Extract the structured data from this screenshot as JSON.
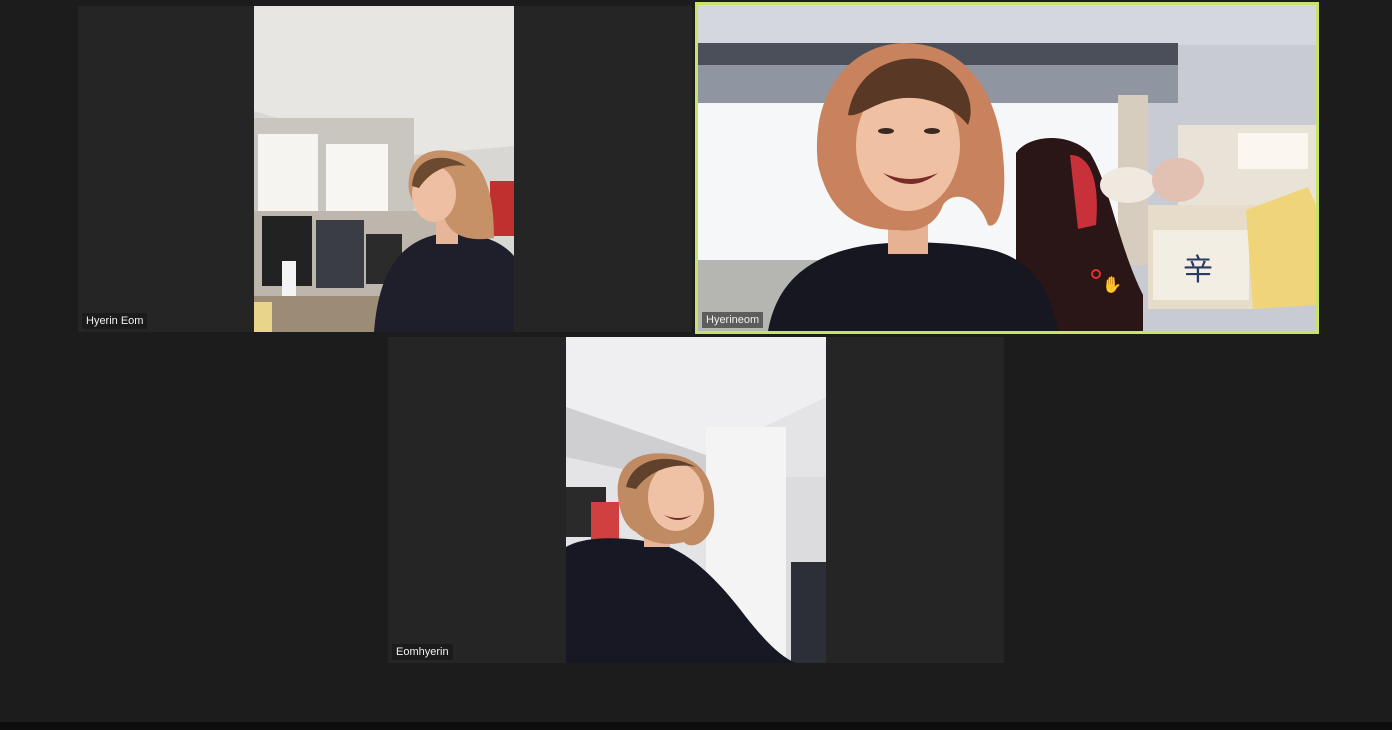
{
  "app": {
    "accent_color": "#c7e36a",
    "background": "#1c1c1c"
  },
  "participants": [
    {
      "name": "Hyerin Eom",
      "active_speaker": false,
      "camera": "on"
    },
    {
      "name": "Hyerineom",
      "active_speaker": true,
      "camera": "on",
      "mic": "muted",
      "reaction_icon": "raised-hand-icon"
    },
    {
      "name": "Eomhyerin",
      "active_speaker": false,
      "camera": "on"
    }
  ]
}
